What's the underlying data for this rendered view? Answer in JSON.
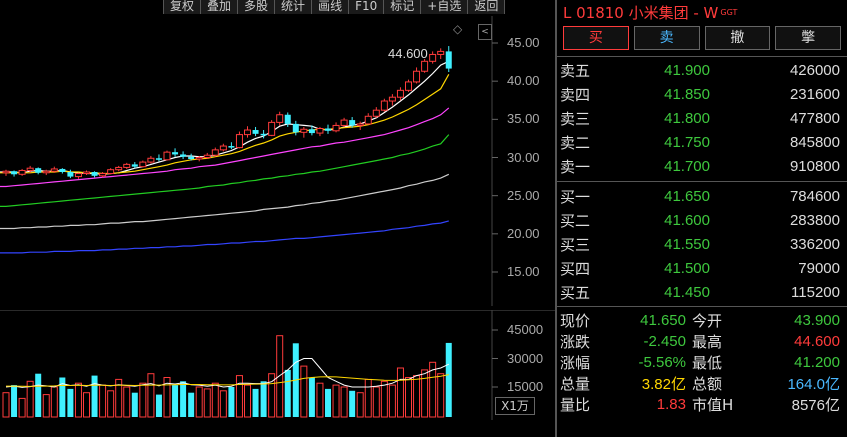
{
  "toolbar": {
    "items": [
      "复权",
      "叠加",
      "多股",
      "统计",
      "画线",
      "F10",
      "标记",
      "+自选",
      "返回"
    ]
  },
  "chart": {
    "max_label": "44.600",
    "diamond": "◇",
    "collapse": "<",
    "unit_label": "X1万",
    "price_ticks": [
      "45.00",
      "40.00",
      "35.00",
      "30.00",
      "25.00",
      "20.00",
      "15.00"
    ],
    "volume_ticks": [
      "45000",
      "30000",
      "15000"
    ]
  },
  "chart_data": {
    "type": "candlestick",
    "price_axis": {
      "min": 12.5,
      "max": 47.0
    },
    "volume_axis": {
      "min": 0,
      "max": 50000
    },
    "candles": [
      [
        28.0,
        28.4,
        27.6,
        28.2,
        12000
      ],
      [
        28.2,
        28.3,
        27.5,
        27.8,
        16000
      ],
      [
        27.8,
        28.5,
        27.6,
        28.3,
        9000
      ],
      [
        28.3,
        28.9,
        28.0,
        28.6,
        18000
      ],
      [
        28.6,
        28.7,
        27.8,
        28.0,
        22000
      ],
      [
        28.0,
        28.4,
        27.7,
        28.2,
        11000
      ],
      [
        28.2,
        28.8,
        28.0,
        28.5,
        15000
      ],
      [
        28.5,
        28.6,
        27.9,
        28.1,
        20000
      ],
      [
        28.1,
        28.4,
        27.3,
        27.5,
        14000
      ],
      [
        27.5,
        28.0,
        27.2,
        27.9,
        17000
      ],
      [
        27.9,
        28.3,
        27.7,
        28.1,
        12000
      ],
      [
        28.1,
        28.2,
        27.4,
        27.6,
        21000
      ],
      [
        27.6,
        28.1,
        27.4,
        27.9,
        16000
      ],
      [
        27.9,
        28.6,
        27.8,
        28.4,
        13000
      ],
      [
        28.4,
        28.9,
        28.2,
        28.7,
        19000
      ],
      [
        28.7,
        29.3,
        28.5,
        29.1,
        15000
      ],
      [
        29.1,
        29.4,
        28.6,
        28.8,
        12000
      ],
      [
        28.8,
        29.6,
        28.7,
        29.4,
        17000
      ],
      [
        29.4,
        30.2,
        29.2,
        29.9,
        22000
      ],
      [
        29.9,
        30.4,
        29.5,
        29.7,
        11000
      ],
      [
        29.7,
        30.9,
        29.6,
        30.7,
        20000
      ],
      [
        30.7,
        31.2,
        30.1,
        30.4,
        16000
      ],
      [
        30.4,
        30.8,
        29.8,
        30.1,
        18000
      ],
      [
        30.1,
        30.5,
        29.6,
        29.8,
        12000
      ],
      [
        29.8,
        30.2,
        29.5,
        30.0,
        15000
      ],
      [
        30.0,
        30.6,
        29.8,
        30.3,
        14000
      ],
      [
        30.3,
        31.3,
        30.1,
        31.0,
        17000
      ],
      [
        31.0,
        31.8,
        30.8,
        31.5,
        13000
      ],
      [
        31.5,
        32.0,
        31.1,
        31.3,
        15000
      ],
      [
        31.3,
        33.4,
        31.2,
        33.0,
        21000
      ],
      [
        33.0,
        34.1,
        32.6,
        33.6,
        16000
      ],
      [
        33.6,
        34.0,
        32.8,
        33.1,
        14000
      ],
      [
        33.1,
        33.6,
        32.5,
        32.9,
        18000
      ],
      [
        32.9,
        34.9,
        32.8,
        34.6,
        22000
      ],
      [
        34.6,
        36.0,
        34.2,
        35.6,
        42000
      ],
      [
        35.6,
        35.9,
        34.0,
        34.4,
        24000
      ],
      [
        34.4,
        34.8,
        32.9,
        33.3,
        38000
      ],
      [
        33.3,
        34.0,
        32.6,
        33.7,
        26000
      ],
      [
        33.7,
        34.2,
        32.9,
        33.2,
        20000
      ],
      [
        33.2,
        34.0,
        32.8,
        33.8,
        17000
      ],
      [
        33.8,
        34.3,
        33.1,
        33.5,
        14000
      ],
      [
        33.5,
        34.6,
        33.3,
        34.2,
        16000
      ],
      [
        34.2,
        35.2,
        34.0,
        34.9,
        15000
      ],
      [
        34.9,
        35.3,
        33.9,
        34.2,
        13000
      ],
      [
        34.2,
        34.7,
        33.6,
        34.4,
        12000
      ],
      [
        34.4,
        35.8,
        34.3,
        35.4,
        19000
      ],
      [
        35.4,
        36.6,
        35.2,
        36.2,
        15000
      ],
      [
        36.2,
        37.7,
        36.0,
        37.4,
        18000
      ],
      [
        37.4,
        38.3,
        36.8,
        37.9,
        16000
      ],
      [
        37.9,
        39.2,
        37.5,
        38.8,
        25000
      ],
      [
        38.8,
        40.2,
        38.6,
        39.9,
        20000
      ],
      [
        39.9,
        41.8,
        39.7,
        41.3,
        21000
      ],
      [
        41.3,
        42.9,
        41.1,
        42.6,
        24000
      ],
      [
        42.6,
        43.9,
        42.3,
        43.5,
        28000
      ],
      [
        43.5,
        44.3,
        42.9,
        43.9,
        22000
      ],
      [
        43.9,
        44.6,
        41.2,
        41.65,
        38200
      ]
    ],
    "ma_series": [
      {
        "color": "#ffffff",
        "values": [
          28.1,
          28.1,
          28.0,
          28.2,
          28.3,
          28.2,
          28.2,
          28.3,
          28.1,
          28.0,
          27.9,
          27.9,
          27.8,
          27.9,
          28.0,
          28.3,
          28.6,
          28.8,
          29.1,
          29.4,
          29.7,
          30.0,
          30.2,
          30.2,
          30.1,
          30.1,
          30.3,
          30.6,
          30.9,
          31.4,
          32.0,
          32.5,
          32.8,
          33.4,
          34.1,
          34.4,
          34.3,
          34.2,
          34.1,
          33.7,
          33.6,
          33.7,
          34.0,
          34.2,
          34.4,
          34.8,
          35.2,
          35.9,
          36.6,
          37.4,
          38.2,
          39.1,
          40.0,
          41.0,
          42.1,
          42.6
        ]
      },
      {
        "color": "#ffd700",
        "values": [
          28.0,
          28.0,
          28.0,
          28.0,
          28.1,
          28.1,
          28.1,
          28.2,
          28.1,
          28.1,
          28.0,
          28.0,
          27.9,
          27.9,
          28.0,
          28.1,
          28.2,
          28.4,
          28.6,
          28.8,
          29.0,
          29.3,
          29.5,
          29.7,
          29.8,
          29.9,
          30.1,
          30.3,
          30.5,
          30.8,
          31.2,
          31.6,
          31.9,
          32.3,
          32.8,
          33.1,
          33.3,
          33.5,
          33.6,
          33.7,
          33.7,
          33.8,
          33.9,
          34.0,
          34.1,
          34.3,
          34.6,
          34.9,
          35.3,
          35.8,
          36.3,
          36.9,
          37.6,
          38.3,
          39.0,
          40.9
        ]
      },
      {
        "color": "#ff44ff",
        "values": [
          26.2,
          26.3,
          26.4,
          26.5,
          26.6,
          26.7,
          26.8,
          26.9,
          27.0,
          27.1,
          27.2,
          27.3,
          27.4,
          27.5,
          27.6,
          27.7,
          27.8,
          27.9,
          28.0,
          28.1,
          28.2,
          28.4,
          28.5,
          28.6,
          28.8,
          28.9,
          29.0,
          29.2,
          29.4,
          29.6,
          29.8,
          30.0,
          30.2,
          30.4,
          30.6,
          30.8,
          31.0,
          31.2,
          31.4,
          31.5,
          31.7,
          31.9,
          32.0,
          32.2,
          32.4,
          32.6,
          32.8,
          33.0,
          33.3,
          33.6,
          33.9,
          34.3,
          34.7,
          35.1,
          35.6,
          36.5
        ]
      },
      {
        "color": "#22cc22",
        "values": [
          23.6,
          23.7,
          23.8,
          23.9,
          24.0,
          24.1,
          24.2,
          24.3,
          24.4,
          24.5,
          24.6,
          24.7,
          24.8,
          24.9,
          25.0,
          25.1,
          25.2,
          25.3,
          25.4,
          25.5,
          25.6,
          25.7,
          25.8,
          25.9,
          26.0,
          26.2,
          26.3,
          26.4,
          26.6,
          26.7,
          26.9,
          27.0,
          27.2,
          27.3,
          27.5,
          27.6,
          27.8,
          27.9,
          28.1,
          28.2,
          28.4,
          28.6,
          28.8,
          29.0,
          29.2,
          29.4,
          29.6,
          29.8,
          30.0,
          30.3,
          30.5,
          30.8,
          31.1,
          31.5,
          31.8,
          33.0
        ]
      },
      {
        "color": "#cccccc",
        "values": [
          20.7,
          20.7,
          20.8,
          20.8,
          20.9,
          20.9,
          21.0,
          21.0,
          21.1,
          21.1,
          21.2,
          21.2,
          21.3,
          21.4,
          21.4,
          21.5,
          21.6,
          21.6,
          21.7,
          21.8,
          21.9,
          22.0,
          22.1,
          22.2,
          22.3,
          22.4,
          22.5,
          22.6,
          22.7,
          22.8,
          22.9,
          23.0,
          23.2,
          23.3,
          23.4,
          23.5,
          23.7,
          23.8,
          24.0,
          24.1,
          24.3,
          24.4,
          24.6,
          24.8,
          25.0,
          25.2,
          25.4,
          25.6,
          25.8,
          26.0,
          26.3,
          26.5,
          26.8,
          27.0,
          27.3,
          27.8
        ]
      },
      {
        "color": "#3344ff",
        "values": [
          17.5,
          17.5,
          17.5,
          17.6,
          17.6,
          17.6,
          17.7,
          17.7,
          17.7,
          17.8,
          17.8,
          17.8,
          17.9,
          17.9,
          18.0,
          18.0,
          18.1,
          18.1,
          18.2,
          18.2,
          18.3,
          18.3,
          18.4,
          18.4,
          18.5,
          18.6,
          18.6,
          18.7,
          18.8,
          18.8,
          18.9,
          19.0,
          19.0,
          19.1,
          19.2,
          19.3,
          19.4,
          19.4,
          19.5,
          19.6,
          19.7,
          19.8,
          19.9,
          20.0,
          20.1,
          20.2,
          20.3,
          20.4,
          20.6,
          20.7,
          20.8,
          21.0,
          21.1,
          21.3,
          21.4,
          21.7
        ]
      }
    ],
    "volume_ma": [
      {
        "color": "#ffffff",
        "values": [
          15000,
          15500,
          14800,
          15200,
          16000,
          15600,
          15000,
          16800,
          15800,
          16200,
          15400,
          16800,
          16000,
          15600,
          16200,
          15800,
          15400,
          16200,
          16800,
          15600,
          17000,
          16600,
          17200,
          16200,
          16000,
          15400,
          16000,
          15000,
          15400,
          17000,
          17000,
          16800,
          16800,
          17800,
          21000,
          24000,
          28000,
          30000,
          30000,
          25000,
          20000,
          18000,
          16000,
          15000,
          15000,
          15000,
          15400,
          16000,
          17000,
          19000,
          19000,
          21000,
          22000,
          24000,
          25000,
          27000
        ]
      },
      {
        "color": "#ffd700",
        "values": [
          15500,
          15500,
          15400,
          15300,
          15400,
          15500,
          15600,
          15800,
          15800,
          15900,
          15800,
          15900,
          15900,
          15800,
          15900,
          15900,
          15800,
          15900,
          16000,
          16000,
          16100,
          16200,
          16300,
          16300,
          16300,
          16200,
          16200,
          16100,
          16100,
          16300,
          16400,
          16500,
          16600,
          16800,
          17300,
          17900,
          18700,
          19500,
          20000,
          20300,
          20400,
          20300,
          20000,
          19700,
          19300,
          19000,
          18800,
          18600,
          18500,
          18600,
          18800,
          19100,
          19500,
          20100,
          20700,
          21500
        ]
      }
    ]
  },
  "panel": {
    "title": "L  01810 小米集团 - W",
    "title_sub": "GGT",
    "buttons": [
      "买",
      "卖",
      "撤",
      "撆"
    ],
    "asks": [
      {
        "label": "卖五",
        "price": "41.900",
        "volume": "426000"
      },
      {
        "label": "卖四",
        "price": "41.850",
        "volume": "231600"
      },
      {
        "label": "卖三",
        "price": "41.800",
        "volume": "477800"
      },
      {
        "label": "卖二",
        "price": "41.750",
        "volume": "845800"
      },
      {
        "label": "卖一",
        "price": "41.700",
        "volume": "910800"
      }
    ],
    "bids": [
      {
        "label": "买一",
        "price": "41.650",
        "volume": "784600"
      },
      {
        "label": "买二",
        "price": "41.600",
        "volume": "283800"
      },
      {
        "label": "买三",
        "price": "41.550",
        "volume": "336200"
      },
      {
        "label": "买四",
        "price": "41.500",
        "volume": "79000"
      },
      {
        "label": "买五",
        "price": "41.450",
        "volume": "115200"
      }
    ],
    "stats": [
      {
        "l1": "现价",
        "v1": "41.650",
        "c1": "#3ec83e",
        "l2": "今开",
        "v2": "43.900",
        "c2": "#3ec83e"
      },
      {
        "l1": "涨跌",
        "v1": "-2.450",
        "c1": "#3ec83e",
        "l2": "最高",
        "v2": "44.600",
        "c2": "#ff3b3b"
      },
      {
        "l1": "涨幅",
        "v1": "-5.56%",
        "c1": "#3ec83e",
        "l2": "最低",
        "v2": "41.200",
        "c2": "#3ec83e"
      },
      {
        "l1": "总量",
        "v1": "3.82亿",
        "c1": "#ffd700",
        "l2": "总额",
        "v2": "164.0亿",
        "c2": "#4ab8ff"
      },
      {
        "l1": "量比",
        "v1": "1.83",
        "c1": "#ff3b3b",
        "l2": "市值H",
        "v2": "8576亿",
        "c2": "#dddddd"
      }
    ]
  }
}
